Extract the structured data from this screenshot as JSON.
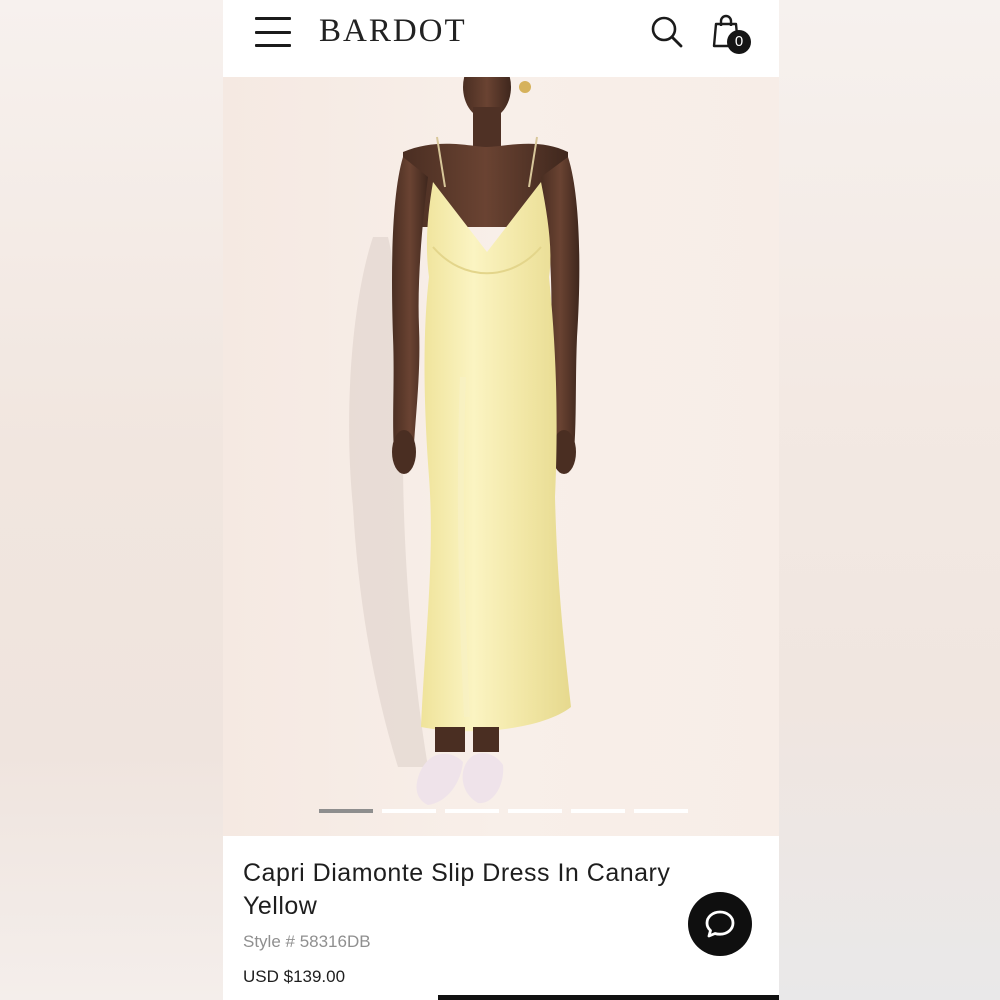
{
  "brand": {
    "logo_text": "BARDOT"
  },
  "header": {
    "menu_icon": "hamburger-menu-icon",
    "search_icon": "search-icon",
    "bag_icon": "shopping-bag-icon",
    "bag_count": "0"
  },
  "gallery": {
    "image_description_icon": "product-photo",
    "slide_count": 6,
    "active_slide": 1
  },
  "product": {
    "title": "Capri Diamonte Slip Dress In Canary Yellow",
    "style": "Style # 58316DB",
    "price": "USD $139.00"
  },
  "chat": {
    "icon": "chat-bubble-icon"
  },
  "colors": {
    "accent": "#0f0f0f",
    "dress": "#f3eaa8",
    "background": "#f6ece6",
    "active_dot": "#8e8e8e"
  }
}
